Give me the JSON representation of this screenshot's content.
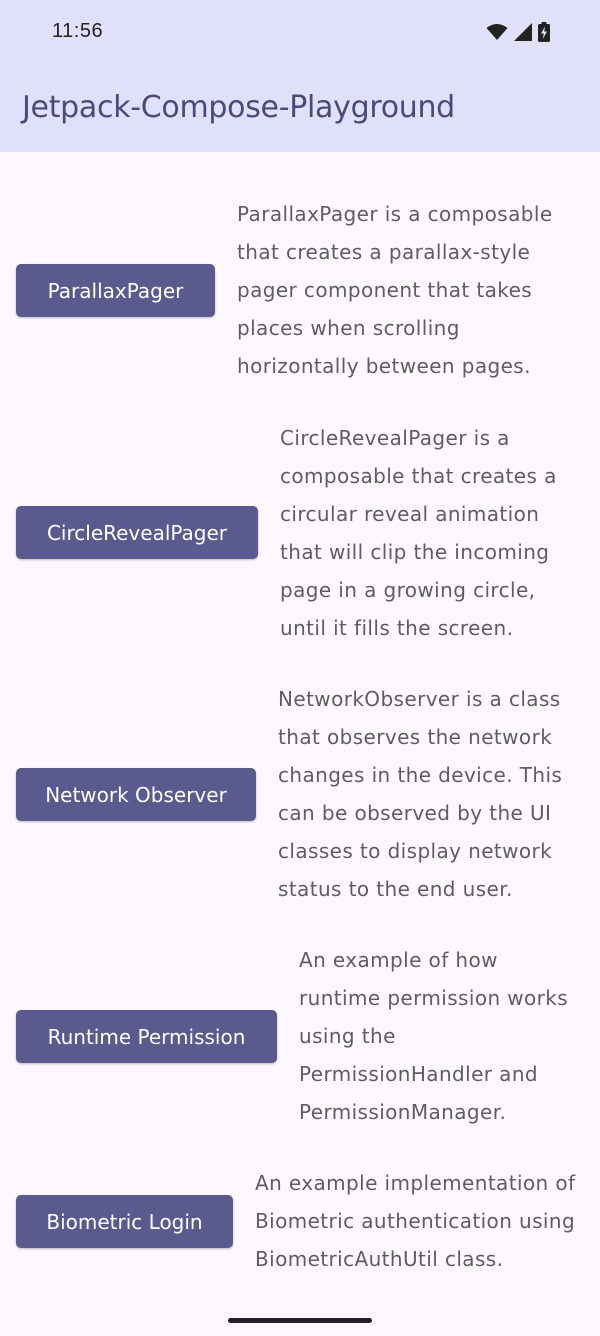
{
  "status_bar": {
    "time": "11:56",
    "icons": [
      "wifi-icon",
      "signal-icon",
      "battery-charging-icon"
    ]
  },
  "app_bar": {
    "title": "Jetpack-Compose-Playground"
  },
  "items": [
    {
      "button_label": "ParallaxPager",
      "description": "ParallaxPager is a composable that creates a parallax-style pager component that takes places when scrolling horizontally between pages."
    },
    {
      "button_label": "CircleRevealPager",
      "description": "CircleRevealPager is a composable that creates a circular reveal animation that will clip the incoming page in a growing circle, until it fills the screen."
    },
    {
      "button_label": "Network Observer",
      "description": "NetworkObserver is a class that observes the network changes in the device. This can be observed by the UI classes to display network status to the end user."
    },
    {
      "button_label": "Runtime Permission",
      "description": "An example of how runtime permission works using the PermissionHandler and PermissionManager."
    },
    {
      "button_label": "Biometric Login",
      "description": "An example implementation of Biometric authentication using BiometricAuthUtil class."
    }
  ],
  "colors": {
    "app_bar_bg": "#e1e0fa",
    "page_bg": "#fcf8fe",
    "button_bg": "#5a5a8f",
    "title_text": "#4a4a7a",
    "description_text": "#5e5e5e"
  }
}
